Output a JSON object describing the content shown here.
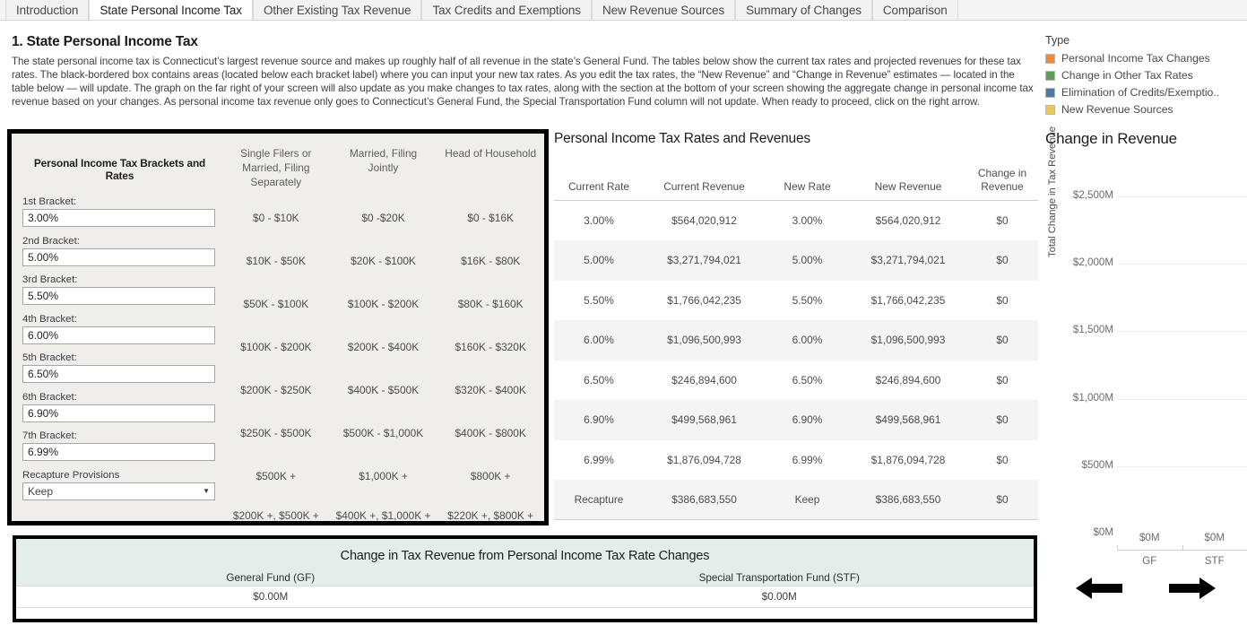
{
  "tabs": [
    {
      "label": "Introduction",
      "active": false
    },
    {
      "label": "State Personal Income Tax",
      "active": true
    },
    {
      "label": "Other Existing Tax Revenue",
      "active": false
    },
    {
      "label": "Tax Credits and Exemptions",
      "active": false
    },
    {
      "label": "New Revenue Sources",
      "active": false
    },
    {
      "label": "Summary of Changes",
      "active": false
    },
    {
      "label": "Comparison",
      "active": false
    }
  ],
  "intro": {
    "heading": "1. State Personal Income Tax",
    "body": "The state personal income tax is Connecticut’s largest revenue source and makes up roughly half of all revenue in the state’s General Fund. The tables below show the current tax rates and projected revenues for these tax rates. The black-bordered box contains areas (located below each bracket label) where you can input your new tax rates. As you edit the tax rates, the “New Revenue” and “Change in Revenue” estimates — located in the table below — will update. The graph on the far right of your screen will also update as you make changes to tax rates, along with the section at the bottom of your screen showing the aggregate change in personal income tax revenue based on your changes. As personal income tax revenue only goes to Connecticut’s General Fund, the Special Transportation Fund column will not update. When ready to proceed, click on the right arrow."
  },
  "legend": {
    "title": "Type",
    "items": [
      {
        "label": "Personal Income Tax Changes",
        "color": "#ED8A3B"
      },
      {
        "label": "Change in Other Tax Rates",
        "color": "#5E9E52"
      },
      {
        "label": "Elimination of Credits/Exemptio..",
        "color": "#4E79A7"
      },
      {
        "label": "New Revenue Sources",
        "color": "#EDC94E"
      }
    ]
  },
  "brackets_panel": {
    "title": "Personal Income Tax Brackets and Rates",
    "column_headers": [
      "Single Filers or Married, Filing Separately",
      "Married, Filing Jointly",
      "Head of Household"
    ],
    "rows": [
      {
        "label": "1st Bracket:",
        "value": "3.00%",
        "single": "$0 - $10K",
        "joint": "$0 -$20K",
        "hoh": "$0 - $16K"
      },
      {
        "label": "2nd Bracket:",
        "value": "5.00%",
        "single": "$10K - $50K",
        "joint": "$20K - $100K",
        "hoh": "$16K - $80K"
      },
      {
        "label": "3rd Bracket:",
        "value": "5.50%",
        "single": "$50K - $100K",
        "joint": "$100K - $200K",
        "hoh": "$80K - $160K"
      },
      {
        "label": "4th Bracket:",
        "value": "6.00%",
        "single": "$100K - $200K",
        "joint": "$200K - $400K",
        "hoh": "$160K - $320K"
      },
      {
        "label": "5th Bracket:",
        "value": "6.50%",
        "single": "$200K - $250K",
        "joint": "$400K - $500K",
        "hoh": "$320K - $400K"
      },
      {
        "label": "6th Bracket:",
        "value": "6.90%",
        "single": "$250K - $500K",
        "joint": "$500K - $1,000K",
        "hoh": "$400K - $800K"
      },
      {
        "label": "7th Bracket:",
        "value": "6.99%",
        "single": "$500K +",
        "joint": "$1,000K +",
        "hoh": "$800K +"
      }
    ],
    "recapture": {
      "label": "Recapture Provisions",
      "value": "Keep",
      "single": "$200K +, $500K +",
      "joint": "$400K +, $1,000K +",
      "hoh": "$220K +, $800K +"
    }
  },
  "revenue_table": {
    "title": "Personal Income Tax Rates and Revenues",
    "headers": [
      "Current Rate",
      "Current Revenue",
      "New Rate",
      "New Revenue",
      "Change in Revenue"
    ],
    "rows": [
      [
        "3.00%",
        "$564,020,912",
        "3.00%",
        "$564,020,912",
        "$0"
      ],
      [
        "5.00%",
        "$3,271,794,021",
        "5.00%",
        "$3,271,794,021",
        "$0"
      ],
      [
        "5.50%",
        "$1,766,042,235",
        "5.50%",
        "$1,766,042,235",
        "$0"
      ],
      [
        "6.00%",
        "$1,096,500,993",
        "6.00%",
        "$1,096,500,993",
        "$0"
      ],
      [
        "6.50%",
        "$246,894,600",
        "6.50%",
        "$246,894,600",
        "$0"
      ],
      [
        "6.90%",
        "$499,568,961",
        "6.90%",
        "$499,568,961",
        "$0"
      ],
      [
        "6.99%",
        "$1,876,094,728",
        "6.99%",
        "$1,876,094,728",
        "$0"
      ],
      [
        "Recapture",
        "$386,683,550",
        "Keep",
        "$386,683,550",
        "$0"
      ]
    ]
  },
  "chart_data": {
    "type": "bar",
    "title": "Change in Revenue",
    "xlabel": "",
    "ylabel": "Total Change in Tax Revenue",
    "categories": [
      "GF",
      "STF"
    ],
    "values": [
      0,
      0
    ],
    "data_labels": [
      "$0M",
      "$0M"
    ],
    "ytick_labels": [
      "$2,500M",
      "$2,000M",
      "$1,500M",
      "$1,000M",
      "$500M",
      "$0M"
    ],
    "ytick_values": [
      2500,
      2000,
      1500,
      1000,
      500,
      0
    ],
    "ylim": [
      0,
      2500
    ],
    "grid": true,
    "legend_position": "top-right"
  },
  "summary": {
    "title": "Change in Tax Revenue from Personal Income Tax Rate Changes",
    "columns": [
      {
        "header": "General Fund (GF)",
        "value": "$0.00M"
      },
      {
        "header": "Special Transportation Fund (STF)",
        "value": "$0.00M"
      }
    ]
  },
  "navigation": {
    "back_icon": "arrow-left-icon",
    "next_icon": "arrow-right-icon"
  }
}
